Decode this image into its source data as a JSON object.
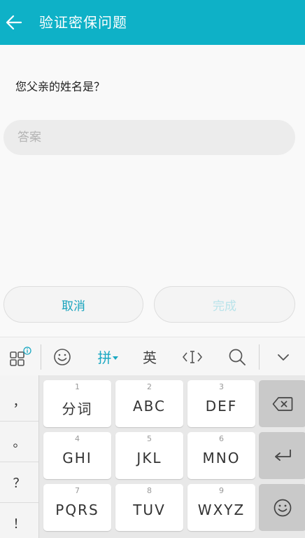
{
  "appbar": {
    "title": "验证密保问题",
    "color": "#0eb1c7",
    "back_icon": "arrow-left-icon"
  },
  "form": {
    "question": "您父亲的姓名是？",
    "answer_placeholder": "答案",
    "answer_value": ""
  },
  "actions": {
    "cancel_label": "取消",
    "done_label": "完成"
  },
  "keyboard": {
    "toolbar": {
      "pinyin_label": "拼",
      "english_label": "英",
      "icons": [
        "grid-menu-icon",
        "emoji-icon",
        "cursor-icon",
        "search-icon",
        "collapse-icon"
      ]
    },
    "punctuation": [
      "，",
      "。",
      "？",
      "！"
    ],
    "keys": [
      {
        "num": "1",
        "label": "分词"
      },
      {
        "num": "2",
        "label": "ABC"
      },
      {
        "num": "3",
        "label": "DEF"
      },
      {
        "num": "4",
        "label": "GHI"
      },
      {
        "num": "5",
        "label": "JKL"
      },
      {
        "num": "6",
        "label": "MNO"
      },
      {
        "num": "7",
        "label": "PQRS"
      },
      {
        "num": "8",
        "label": "TUV"
      },
      {
        "num": "9",
        "label": "WXYZ"
      }
    ],
    "side_icons": [
      "backspace-icon",
      "enter-icon",
      "emoji-icon"
    ]
  }
}
